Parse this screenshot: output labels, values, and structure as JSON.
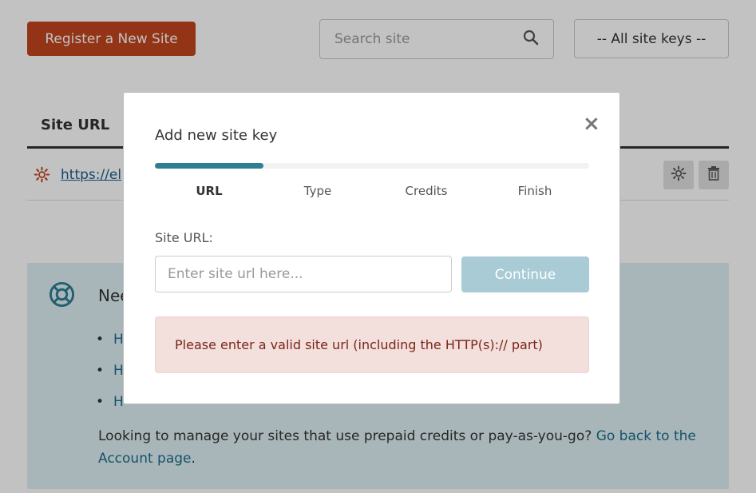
{
  "toolbar": {
    "register_label": "Register a New Site",
    "search_placeholder": "Search site",
    "sitekey_filter": "-- All site keys --"
  },
  "table": {
    "column_header": "Site URL",
    "rows": [
      {
        "url": "https://el"
      }
    ]
  },
  "help": {
    "title": "Nee",
    "links": [
      "H",
      "H",
      "H"
    ],
    "footer_text": "Looking to manage your sites that use prepaid credits or pay-as-you-go?",
    "footer_link": "Go back to the Account page",
    "footer_end": "."
  },
  "modal": {
    "title": "Add new site key",
    "close_glyph": "×",
    "progress_fraction": 0.25,
    "steps": [
      "URL",
      "Type",
      "Credits",
      "Finish"
    ],
    "active_step": 0,
    "field_label": "Site URL:",
    "input_placeholder": "Enter site url here...",
    "continue_label": "Continue",
    "error_message": "Please enter a valid site url (including the HTTP(s):// part)"
  },
  "colors": {
    "brand": "#c2451e",
    "accent": "#2f7f92",
    "error_bg": "#f3dfdc",
    "error_text": "#7a2519"
  },
  "icons": [
    "search-icon",
    "gear-icon",
    "trash-icon",
    "lifebuoy-icon",
    "close-icon"
  ]
}
